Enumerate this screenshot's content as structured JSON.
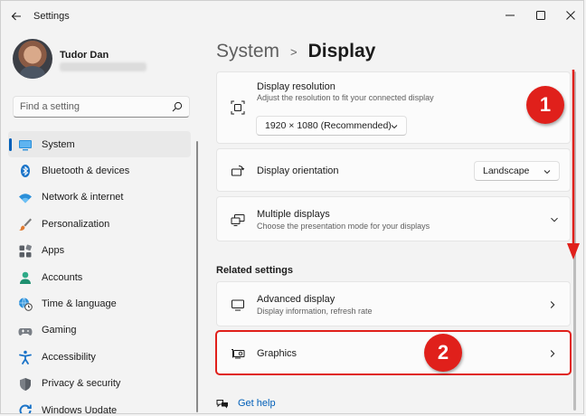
{
  "window": {
    "title": "Settings"
  },
  "profile": {
    "name": "Tudor Dan"
  },
  "search": {
    "placeholder": "Find a setting"
  },
  "sidebar": {
    "items": [
      {
        "label": "System",
        "icon": "monitor-icon",
        "active": true
      },
      {
        "label": "Bluetooth & devices",
        "icon": "bluetooth-icon"
      },
      {
        "label": "Network & internet",
        "icon": "wifi-icon"
      },
      {
        "label": "Personalization",
        "icon": "brush-icon"
      },
      {
        "label": "Apps",
        "icon": "apps-icon"
      },
      {
        "label": "Accounts",
        "icon": "person-icon"
      },
      {
        "label": "Time & language",
        "icon": "clock-globe-icon"
      },
      {
        "label": "Gaming",
        "icon": "gamepad-icon"
      },
      {
        "label": "Accessibility",
        "icon": "accessibility-icon"
      },
      {
        "label": "Privacy & security",
        "icon": "shield-icon"
      },
      {
        "label": "Windows Update",
        "icon": "update-icon"
      }
    ]
  },
  "breadcrumb": {
    "parent": "System",
    "separator": ">",
    "current": "Display"
  },
  "cards": {
    "resolution": {
      "title": "Display resolution",
      "subtitle": "Adjust the resolution to fit your connected display",
      "value": "1920 × 1080 (Recommended)"
    },
    "orientation": {
      "title": "Display orientation",
      "value": "Landscape"
    },
    "multiple": {
      "title": "Multiple displays",
      "subtitle": "Choose the presentation mode for your displays"
    }
  },
  "related": {
    "heading": "Related settings",
    "advanced": {
      "title": "Advanced display",
      "subtitle": "Display information, refresh rate"
    },
    "graphics": {
      "title": "Graphics"
    }
  },
  "help": {
    "label": "Get help"
  },
  "annotations": {
    "step1": "1",
    "step2": "2",
    "color": "#e0201b"
  },
  "colors": {
    "accent": "#005fb8",
    "background": "#f3f3f3",
    "card": "#fbfbfb"
  }
}
